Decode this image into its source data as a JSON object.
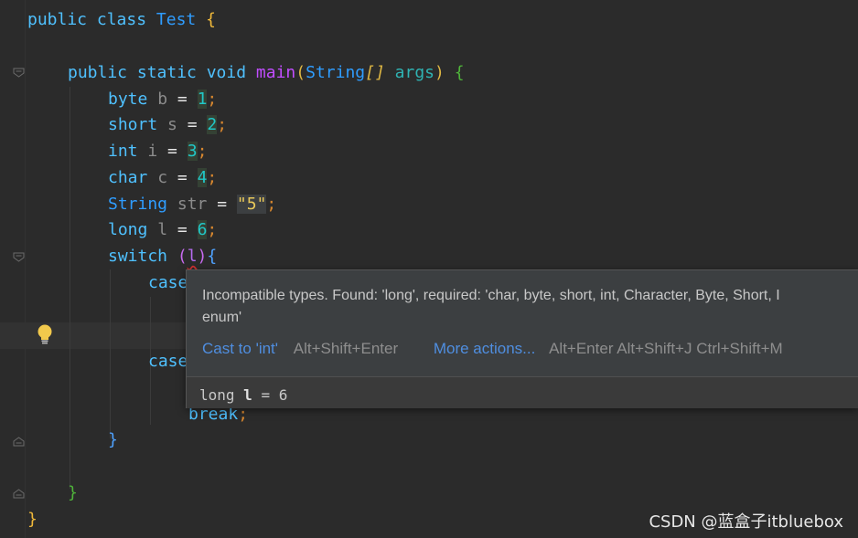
{
  "editor": {
    "lines": [
      {
        "tokens": [
          {
            "t": "public class ",
            "c": "kw"
          },
          {
            "t": "Test ",
            "c": "cls"
          },
          {
            "t": "{",
            "c": "brace-y"
          }
        ]
      },
      {
        "tokens": [
          {
            "t": "public static void ",
            "c": "kw"
          },
          {
            "t": "main",
            "c": "fn"
          },
          {
            "t": "(",
            "c": "paren-y"
          },
          {
            "t": "String",
            "c": "cls"
          },
          {
            "t": "[]",
            "c": "bracket-i"
          },
          {
            "t": " args",
            "c": "param"
          },
          {
            "t": ") ",
            "c": "paren-y"
          },
          {
            "t": "{",
            "c": "brace-g"
          }
        ]
      },
      {
        "tokens": [
          {
            "t": "byte ",
            "c": "kw"
          },
          {
            "t": "b ",
            "c": "var"
          },
          {
            "t": "= ",
            "c": "op"
          },
          {
            "t": "1",
            "c": "num"
          },
          {
            "t": ";",
            "c": "semi"
          }
        ]
      },
      {
        "tokens": [
          {
            "t": "short ",
            "c": "kw"
          },
          {
            "t": "s ",
            "c": "var"
          },
          {
            "t": "= ",
            "c": "op"
          },
          {
            "t": "2",
            "c": "num"
          },
          {
            "t": ";",
            "c": "semi"
          }
        ]
      },
      {
        "tokens": [
          {
            "t": "int ",
            "c": "kw"
          },
          {
            "t": "i ",
            "c": "var"
          },
          {
            "t": "= ",
            "c": "op"
          },
          {
            "t": "3",
            "c": "num"
          },
          {
            "t": ";",
            "c": "semi"
          }
        ]
      },
      {
        "tokens": [
          {
            "t": "char ",
            "c": "kw"
          },
          {
            "t": "c ",
            "c": "var"
          },
          {
            "t": "= ",
            "c": "op"
          },
          {
            "t": "4",
            "c": "num"
          },
          {
            "t": ";",
            "c": "semi"
          }
        ]
      },
      {
        "tokens": [
          {
            "t": "String ",
            "c": "cls"
          },
          {
            "t": "str ",
            "c": "var"
          },
          {
            "t": "= ",
            "c": "op"
          },
          {
            "t": "\"5\"",
            "c": "str"
          },
          {
            "t": ";",
            "c": "semi"
          }
        ]
      },
      {
        "tokens": [
          {
            "t": "long ",
            "c": "kw"
          },
          {
            "t": "l ",
            "c": "var"
          },
          {
            "t": "= ",
            "c": "op"
          },
          {
            "t": "6",
            "c": "num"
          },
          {
            "t": ";",
            "c": "semi"
          }
        ]
      },
      {
        "tokens": [
          {
            "t": "switch ",
            "c": "kw"
          },
          {
            "t": "(",
            "c": "paren-p"
          },
          {
            "t": "l",
            "c": "param-l"
          },
          {
            "t": ")",
            "c": "paren-p"
          },
          {
            "t": "{",
            "c": "brace-b"
          }
        ]
      },
      {
        "tokens": [
          {
            "t": "case",
            "c": "kw"
          }
        ]
      },
      {
        "tokens": [
          {
            "t": "case",
            "c": "kw"
          }
        ]
      },
      {
        "tokens": [
          {
            "t": "break",
            "c": "kw"
          },
          {
            "t": ";",
            "c": "semi"
          }
        ]
      },
      {
        "tokens": [
          {
            "t": "}",
            "c": "brace-b"
          }
        ]
      },
      {
        "tokens": [
          {
            "t": "}",
            "c": "brace-g"
          }
        ]
      },
      {
        "tokens": [
          {
            "t": "}",
            "c": "brace-y"
          }
        ]
      }
    ]
  },
  "popup": {
    "message": "Incompatible types. Found: 'long', required: 'char, byte, short, int, Character, Byte, Short, Integer, String, or an enum'",
    "message_visible": "Incompatible types. Found: 'long', required: 'char, byte, short, int, Character, Byte, Short, I\nenum'",
    "action_primary": "Cast to 'int'",
    "action_primary_key": "Alt+Shift+Enter",
    "action_more": "More actions...",
    "action_more_keys": "Alt+Enter Alt+Shift+J Ctrl+Shift+M",
    "declaration_prefix": "long ",
    "declaration_name": "l",
    "declaration_suffix": " = 6"
  },
  "watermark": "CSDN @蓝盒子itbluebox",
  "icons": {
    "fold_open": "fold-open-icon",
    "fold_close": "fold-close-icon",
    "intention": "lightbulb-icon"
  }
}
